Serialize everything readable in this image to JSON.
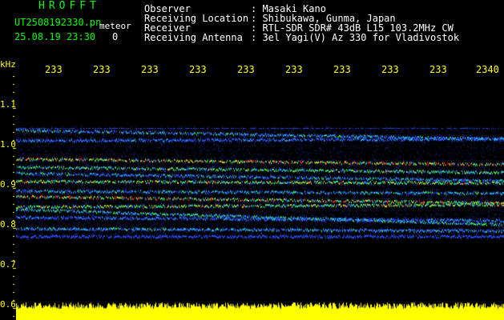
{
  "header": {
    "brand": "HROFFT",
    "filename": "UT2508192330.pn",
    "tag": "meteor",
    "datetime": "25.08.19 23:30",
    "zero": "0",
    "fields": [
      {
        "label": "Observer",
        "value": ": Masaki Kano"
      },
      {
        "label": "Receiving Location",
        "value": ": Shibukawa, Gunma, Japan"
      },
      {
        "label": "Receiver",
        "value": ": RTL-SDR SDR# 43dB L15 103.2MHz CW"
      },
      {
        "label": "Receiving Antenna",
        "value": ": 3el Yagi(V) Az 330 for Vladivostok"
      }
    ]
  },
  "time_axis": [
    "233",
    "233",
    "233",
    "233",
    "233",
    "233",
    "233",
    "233",
    "233",
    "2340"
  ],
  "freq_axis": {
    "unit": "kHz",
    "labels": [
      "1.1",
      "1.0",
      "0.9",
      "0.8",
      "0.7",
      "0.6"
    ]
  },
  "colors": {
    "header_green": "#00ff00",
    "axis_yellow": "#ffff00",
    "background": "#000000",
    "level_bar": "#ffff00"
  }
}
